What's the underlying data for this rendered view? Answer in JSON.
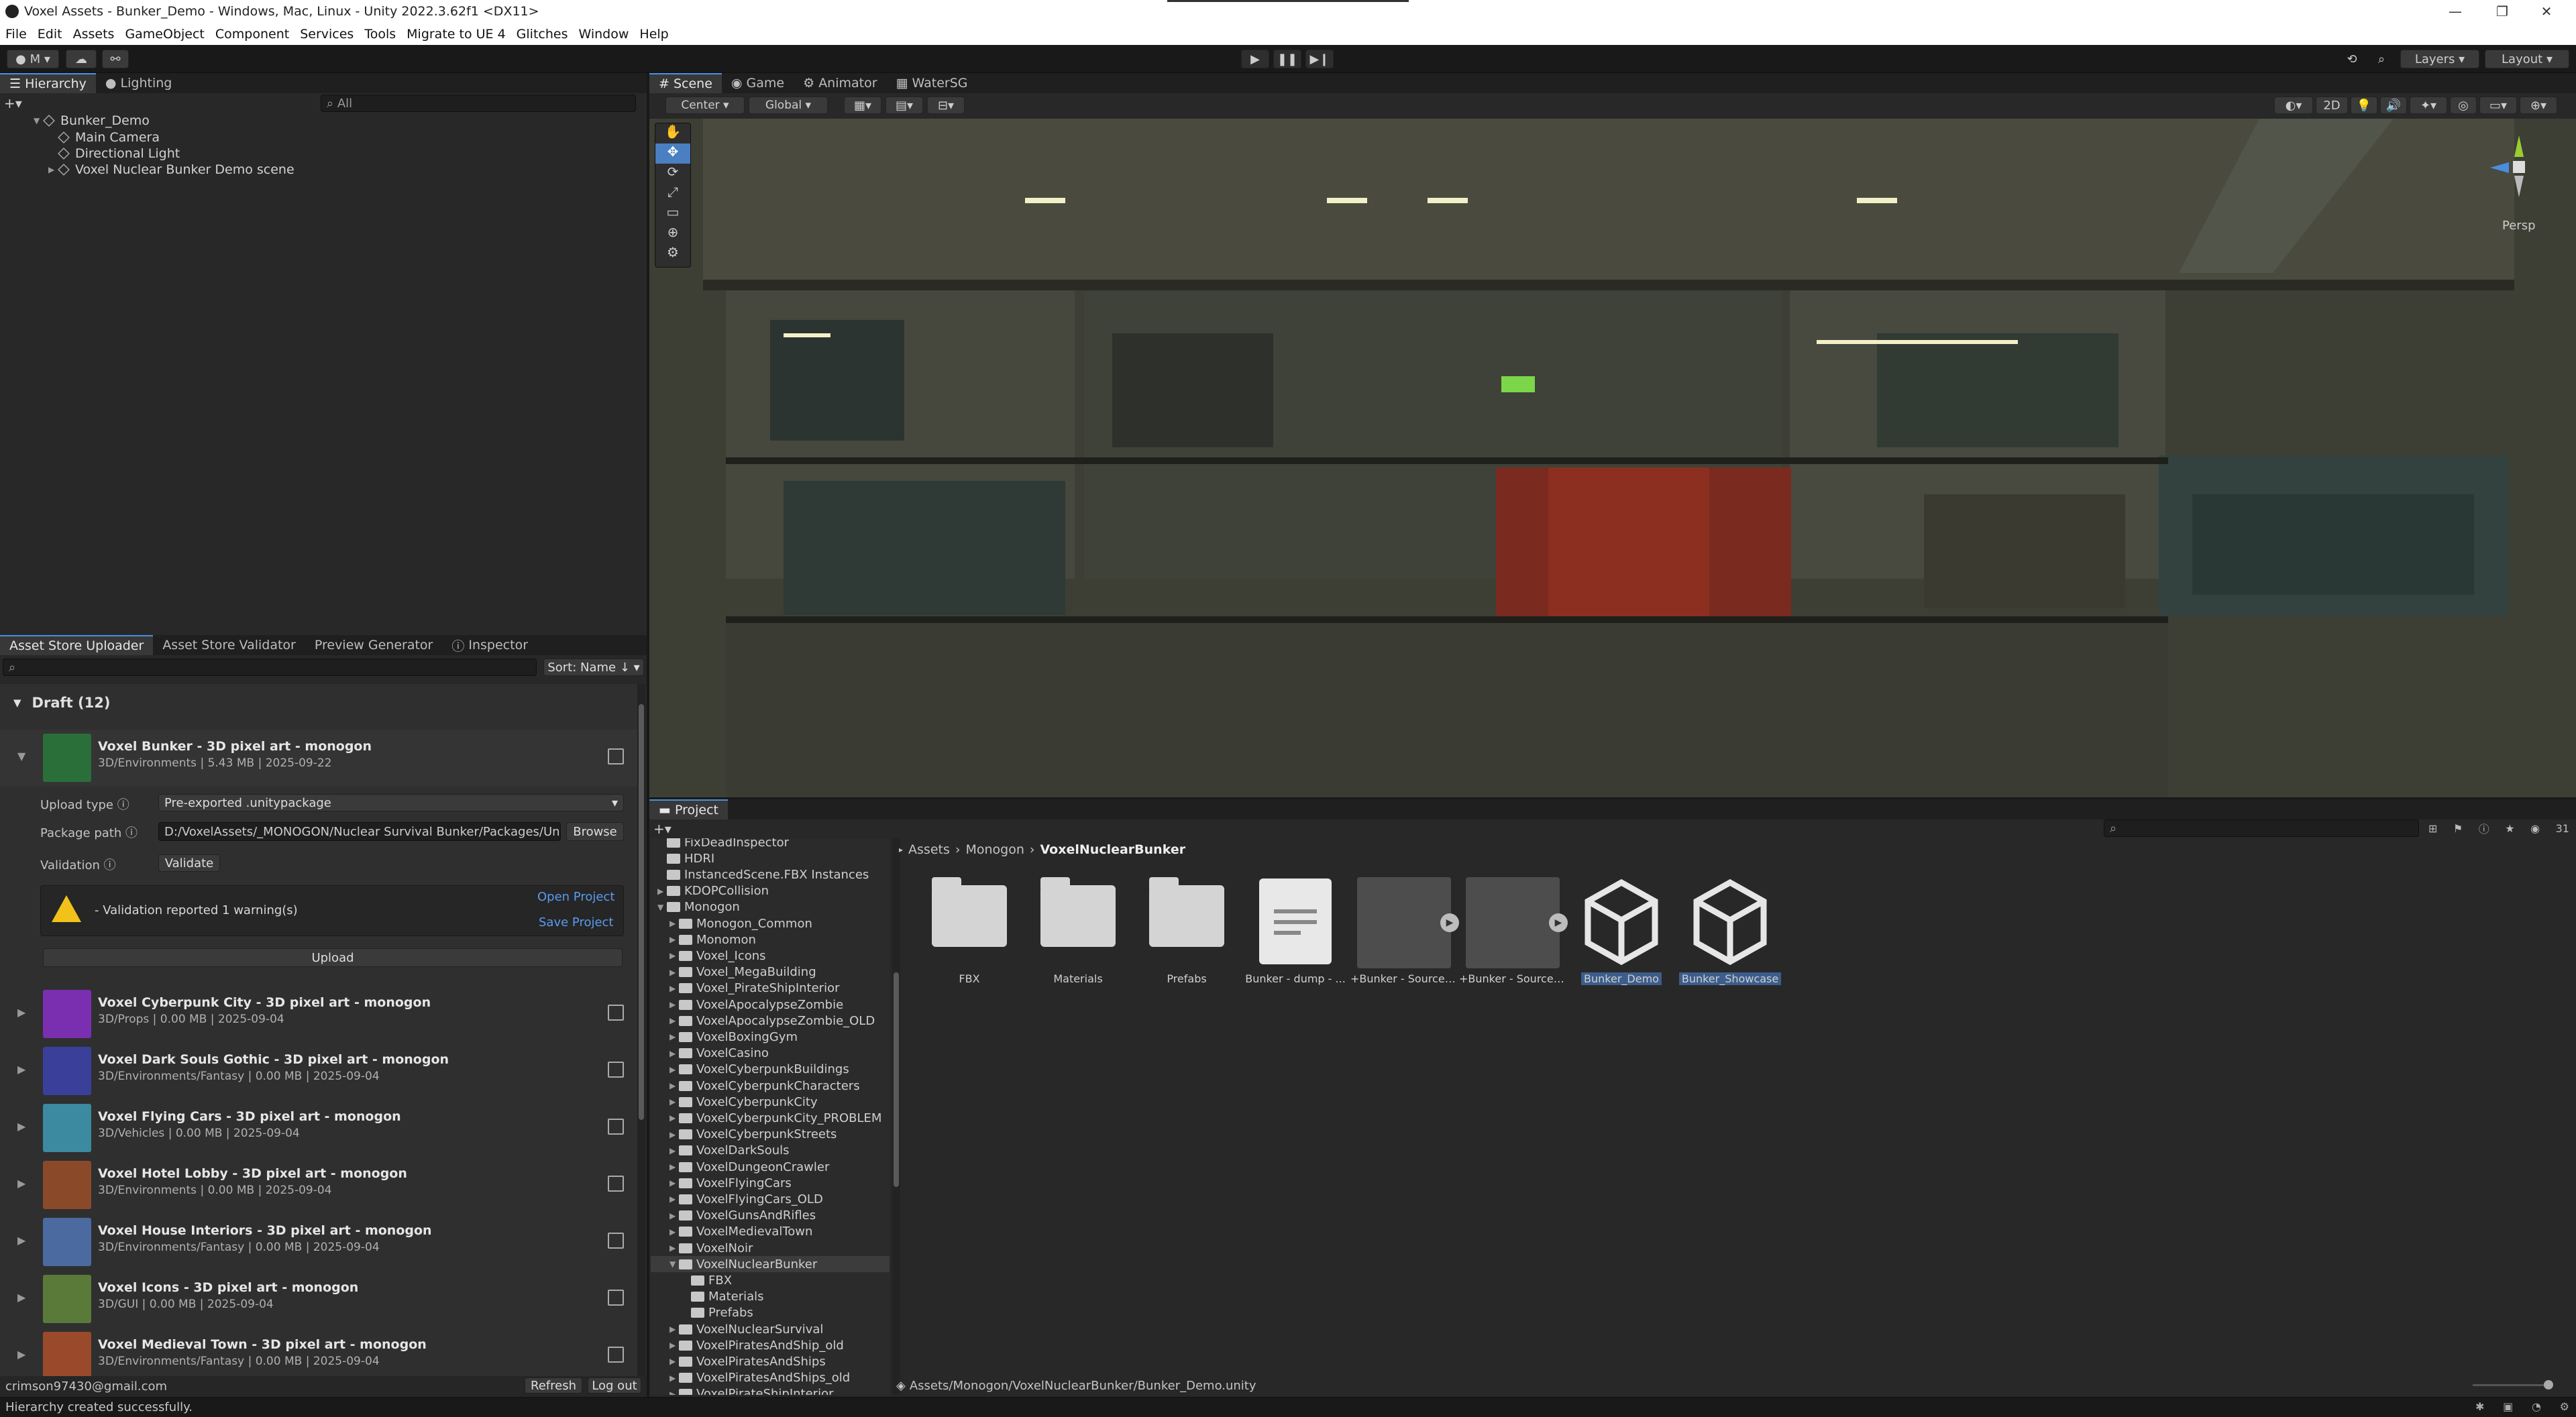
{
  "window": {
    "title": "Voxel Assets - Bunker_Demo - Windows, Mac, Linux - Unity 2022.3.62f1 <DX11>"
  },
  "menu": [
    "File",
    "Edit",
    "Assets",
    "GameObject",
    "Component",
    "Services",
    "Tools",
    "Migrate to UE 4",
    "Glitches",
    "Window",
    "Help"
  ],
  "toolbar": {
    "account": "M",
    "layers": "Layers",
    "layout": "Layout"
  },
  "hierarchy": {
    "tabs": [
      "Hierarchy",
      "Lighting"
    ],
    "search_placeholder": "All",
    "scene": "Bunker_Demo",
    "items": [
      "Main Camera",
      "Directional Light",
      "Voxel Nuclear Bunker Demo scene"
    ]
  },
  "scene_view": {
    "tabs": [
      "Scene",
      "Game",
      "Animator",
      "WaterSG"
    ],
    "pivot": "Center",
    "space": "Global",
    "mode_2d": "2D",
    "projection": "Persp"
  },
  "uploader": {
    "tabs": [
      "Asset Store Uploader",
      "Asset Store Validator",
      "Preview Generator",
      "Inspector"
    ],
    "sort": "Sort: Name ↓",
    "draft_header": "Draft (12)",
    "selected": {
      "name": "Voxel Bunker - 3D pixel art - monogon",
      "meta": "3D/Environments | 5.43 MB | 2025-09-22",
      "upload_type_label": "Upload type",
      "upload_type_value": "Pre-exported .unitypackage",
      "package_path_label": "Package path",
      "package_path_value": "D:/VoxelAssets/_MONOGON/Nuclear Survival Bunker/Packages/Unity",
      "browse": "Browse",
      "validation_label": "Validation",
      "validate": "Validate",
      "warning": "- Validation reported 1 warning(s)",
      "open_project": "Open Project",
      "save_project": "Save Project",
      "upload": "Upload"
    },
    "packages": [
      {
        "name": "Voxel Cyberpunk City - 3D pixel art - monogon",
        "meta": "3D/Props | 0.00 MB | 2025-09-04",
        "color": "#7a2fb0"
      },
      {
        "name": "Voxel Dark Souls Gothic - 3D pixel art - monogon",
        "meta": "3D/Environments/Fantasy | 0.00 MB | 2025-09-04",
        "color": "#3a3f9a"
      },
      {
        "name": "Voxel Flying Cars - 3D pixel art - monogon",
        "meta": "3D/Vehicles | 0.00 MB | 2025-09-04",
        "color": "#3b8aa0"
      },
      {
        "name": "Voxel Hotel Lobby - 3D pixel art - monogon",
        "meta": "3D/Environments | 0.00 MB | 2025-09-04",
        "color": "#8a4a2a"
      },
      {
        "name": "Voxel House Interiors - 3D pixel art - monogon",
        "meta": "3D/Environments/Fantasy | 0.00 MB | 2025-09-04",
        "color": "#4a6aa0"
      },
      {
        "name": "Voxel Icons - 3D pixel art - monogon",
        "meta": "3D/GUI | 0.00 MB | 2025-09-04",
        "color": "#5a7a3a"
      },
      {
        "name": "Voxel Medieval Town - 3D pixel art - monogon",
        "meta": "3D/Environments/Fantasy | 0.00 MB | 2025-09-04",
        "color": "#9a4a2a"
      }
    ],
    "user": "crimson97430@gmail.com",
    "refresh": "Refresh",
    "logout": "Log out"
  },
  "project": {
    "tab": "Project",
    "slider_count": "31",
    "tree": [
      {
        "label": "FixDeadInspector",
        "depth": 1,
        "arrow": ""
      },
      {
        "label": "HDRI",
        "depth": 1,
        "arrow": ""
      },
      {
        "label": "InstancedScene.FBX Instances",
        "depth": 1,
        "arrow": ""
      },
      {
        "label": "KDOPCollision",
        "depth": 1,
        "arrow": "▶"
      },
      {
        "label": "Monogon",
        "depth": 1,
        "arrow": "▼"
      },
      {
        "label": "Monogon_Common",
        "depth": 2,
        "arrow": "▶"
      },
      {
        "label": "Monomon",
        "depth": 2,
        "arrow": "▶"
      },
      {
        "label": "Voxel_Icons",
        "depth": 2,
        "arrow": "▶"
      },
      {
        "label": "Voxel_MegaBuilding",
        "depth": 2,
        "arrow": "▶"
      },
      {
        "label": "Voxel_PirateShipInterior",
        "depth": 2,
        "arrow": "▶"
      },
      {
        "label": "VoxelApocalypseZombie",
        "depth": 2,
        "arrow": "▶"
      },
      {
        "label": "VoxelApocalypseZombie_OLD",
        "depth": 2,
        "arrow": "▶"
      },
      {
        "label": "VoxelBoxingGym",
        "depth": 2,
        "arrow": "▶"
      },
      {
        "label": "VoxelCasino",
        "depth": 2,
        "arrow": "▶"
      },
      {
        "label": "VoxelCyberpunkBuildings",
        "depth": 2,
        "arrow": "▶"
      },
      {
        "label": "VoxelCyberpunkCharacters",
        "depth": 2,
        "arrow": "▶"
      },
      {
        "label": "VoxelCyberpunkCity",
        "depth": 2,
        "arrow": "▶"
      },
      {
        "label": "VoxelCyberpunkCity_PROBLEM",
        "depth": 2,
        "arrow": "▶"
      },
      {
        "label": "VoxelCyberpunkStreets",
        "depth": 2,
        "arrow": "▶"
      },
      {
        "label": "VoxelDarkSouls",
        "depth": 2,
        "arrow": "▶"
      },
      {
        "label": "VoxelDungeonCrawler",
        "depth": 2,
        "arrow": "▶"
      },
      {
        "label": "VoxelFlyingCars",
        "depth": 2,
        "arrow": "▶"
      },
      {
        "label": "VoxelFlyingCars_OLD",
        "depth": 2,
        "arrow": "▶"
      },
      {
        "label": "VoxelGunsAndRifles",
        "depth": 2,
        "arrow": "▶"
      },
      {
        "label": "VoxelMedievalTown",
        "depth": 2,
        "arrow": "▶"
      },
      {
        "label": "VoxelNoir",
        "depth": 2,
        "arrow": "▶"
      },
      {
        "label": "VoxelNuclearBunker",
        "depth": 2,
        "arrow": "▼"
      },
      {
        "label": "FBX",
        "depth": 3,
        "arrow": ""
      },
      {
        "label": "Materials",
        "depth": 3,
        "arrow": ""
      },
      {
        "label": "Prefabs",
        "depth": 3,
        "arrow": ""
      },
      {
        "label": "VoxelNuclearSurvival",
        "depth": 2,
        "arrow": "▶"
      },
      {
        "label": "VoxelPiratesAndShip_old",
        "depth": 2,
        "arrow": "▶"
      },
      {
        "label": "VoxelPiratesAndShips",
        "depth": 2,
        "arrow": "▶"
      },
      {
        "label": "VoxelPiratesAndShips_old",
        "depth": 2,
        "arrow": "▶"
      },
      {
        "label": "VoxelPirateShipInterior",
        "depth": 2,
        "arrow": "▶"
      }
    ],
    "breadcrumb": [
      "Assets",
      "Monogon",
      "VoxelNuclearBunker"
    ],
    "assets": [
      {
        "label": "FBX",
        "kind": "folder"
      },
      {
        "label": "Materials",
        "kind": "folder"
      },
      {
        "label": "Prefabs",
        "kind": "folder"
      },
      {
        "label": "Bunker - dump - ...",
        "kind": "doc"
      },
      {
        "label": "+Bunker - Source -...",
        "kind": "model"
      },
      {
        "label": "+Bunker - Source -...",
        "kind": "model"
      },
      {
        "label": "Bunker_Demo",
        "kind": "unity"
      },
      {
        "label": "Bunker_Showcase",
        "kind": "unity"
      }
    ],
    "path": "Assets/Monogon/VoxelNuclearBunker/Bunker_Demo.unity"
  },
  "status": "Hierarchy created successfully."
}
